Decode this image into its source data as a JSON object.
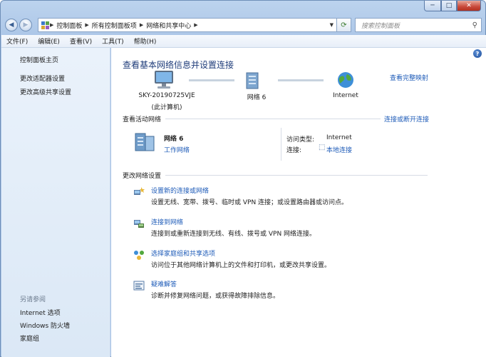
{
  "window": {
    "minimize_glyph": "─",
    "maximize_glyph": "□",
    "close_glyph": "✕"
  },
  "address": {
    "crumbs": [
      "控制面板",
      "所有控制面板项",
      "网络和共享中心"
    ],
    "back_icon": "back-arrow-icon",
    "forward_icon": "forward-arrow-icon",
    "refresh_icon": "refresh-icon"
  },
  "search": {
    "placeholder": "搜索控制面板"
  },
  "menu": [
    "文件(F)",
    "编辑(E)",
    "查看(V)",
    "工具(T)",
    "帮助(H)"
  ],
  "sidebar": {
    "links": [
      "控制面板主页",
      "更改适配器设置",
      "更改高级共享设置"
    ],
    "see_also_header": "另请参阅",
    "see_also": [
      "Internet 选项",
      "Windows 防火墙",
      "家庭组"
    ]
  },
  "main": {
    "title": "查看基本网络信息并设置连接",
    "full_map": "查看完整映射",
    "nodes": [
      {
        "label": "SKY-20190725VJE",
        "sub": "(此计算机)"
      },
      {
        "label": "网络  6",
        "sub": ""
      },
      {
        "label": "Internet",
        "sub": ""
      }
    ],
    "active_header": "查看活动网络",
    "connect_disconnect": "连接或断开连接",
    "network": {
      "name": "网络  6",
      "type_link": "工作网络",
      "access_label": "访问类型:",
      "access_value": "Internet",
      "conn_label": "连接:",
      "conn_value": "本地连接"
    },
    "change_header": "更改网络设置",
    "tasks": [
      {
        "title": "设置新的连接或网络",
        "desc": "设置无线、宽带、拨号、临时或 VPN 连接；或设置路由器或访问点。"
      },
      {
        "title": "连接到网络",
        "desc": "连接到或重新连接到无线、有线、拨号或 VPN 网络连接。"
      },
      {
        "title": "选择家庭组和共享选项",
        "desc": "访问位于其他网络计算机上的文件和打印机，或更改共享设置。"
      },
      {
        "title": "疑难解答",
        "desc": "诊断并修复网络问题，或获得故障排除信息。"
      }
    ]
  },
  "colors": {
    "link": "#1e5bb8",
    "title": "#1f3c7a",
    "sidebar_bg": "#dbe8f6",
    "close_btn": "#c8493a"
  }
}
